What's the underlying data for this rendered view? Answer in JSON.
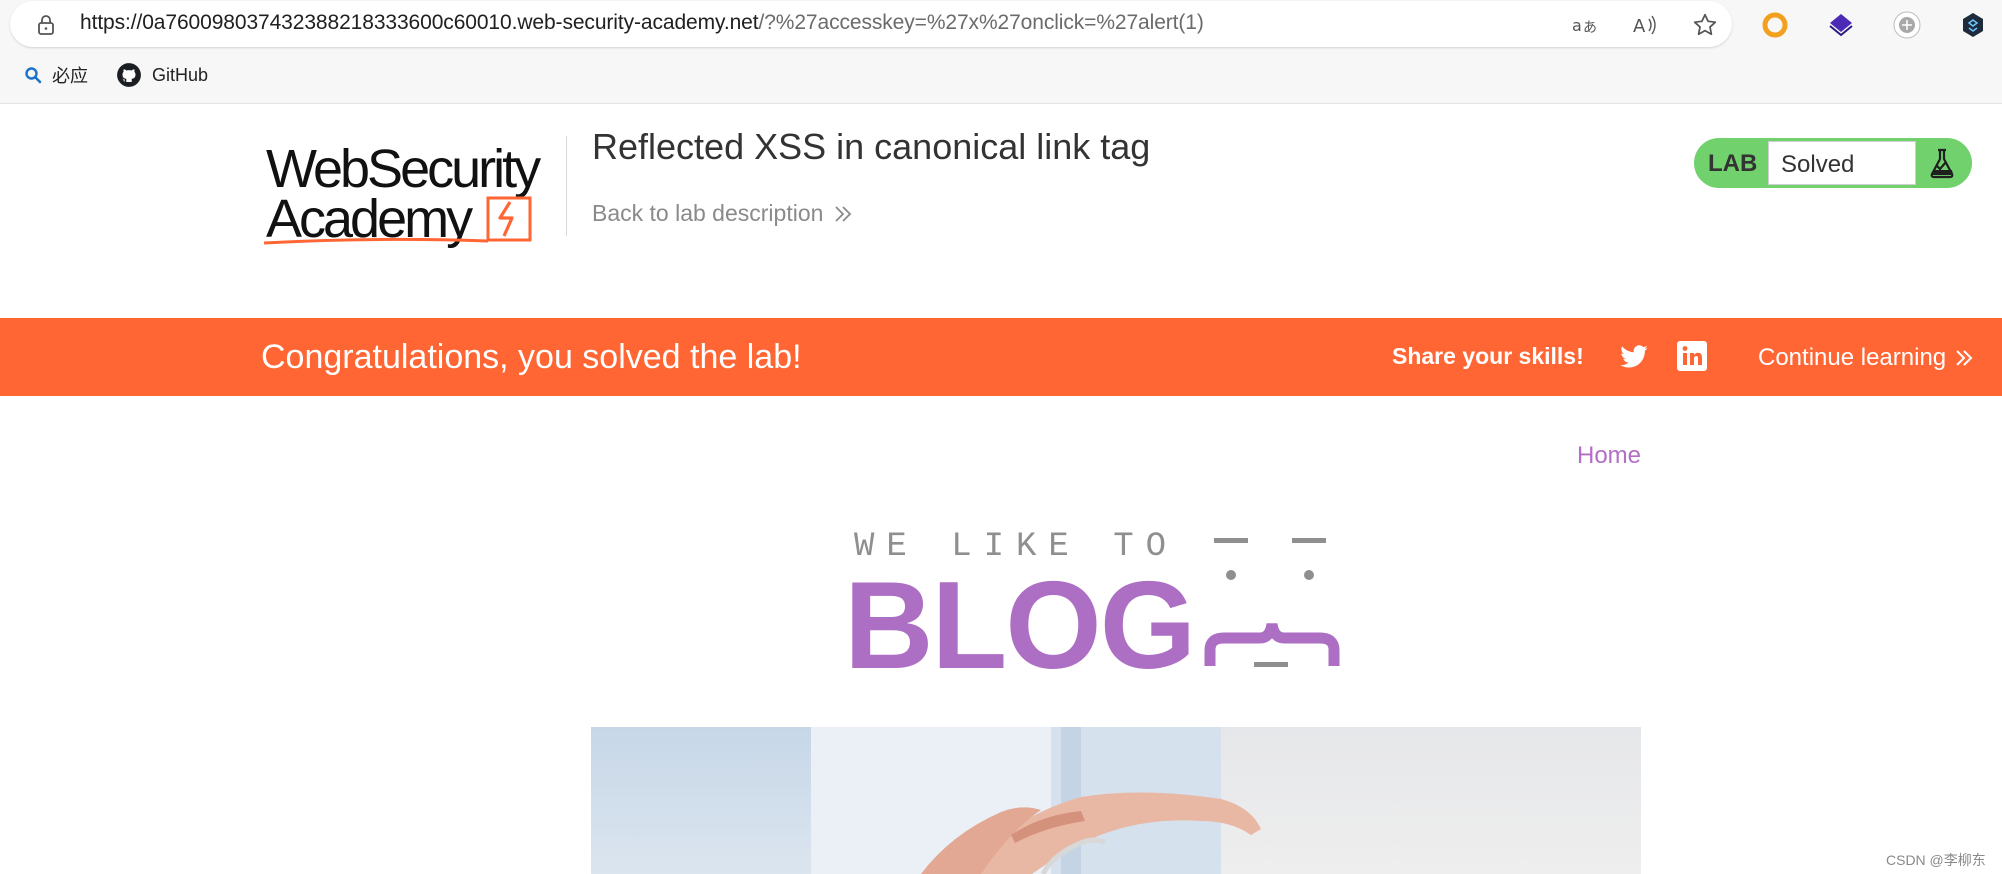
{
  "browser": {
    "url_host": "https://0a760098037432388218333600c60010.web-security-academy.net",
    "url_path": "/?%27accesskey=%27x%27onclick=%27alert(1)",
    "bookmarks": [
      {
        "label": "必应",
        "icon": "search-icon"
      },
      {
        "label": "GitHub",
        "icon": "github-icon"
      }
    ]
  },
  "lab": {
    "logo_line1": "WebSecurity",
    "logo_line2": "Academy",
    "title": "Reflected XSS in canonical link tag",
    "back_link": "Back to lab description",
    "widget_label": "LAB",
    "status": "Solved",
    "widget_color": "#70d16d"
  },
  "banner": {
    "message": "Congratulations, you solved the lab!",
    "share": "Share your skills!",
    "continue": "Continue learning",
    "color": "#ff6633"
  },
  "blog": {
    "nav_home": "Home",
    "tagline": "WE LIKE TO",
    "word": "BLOG",
    "accent": "#ad6fc4"
  },
  "watermark": "CSDN @李柳东"
}
